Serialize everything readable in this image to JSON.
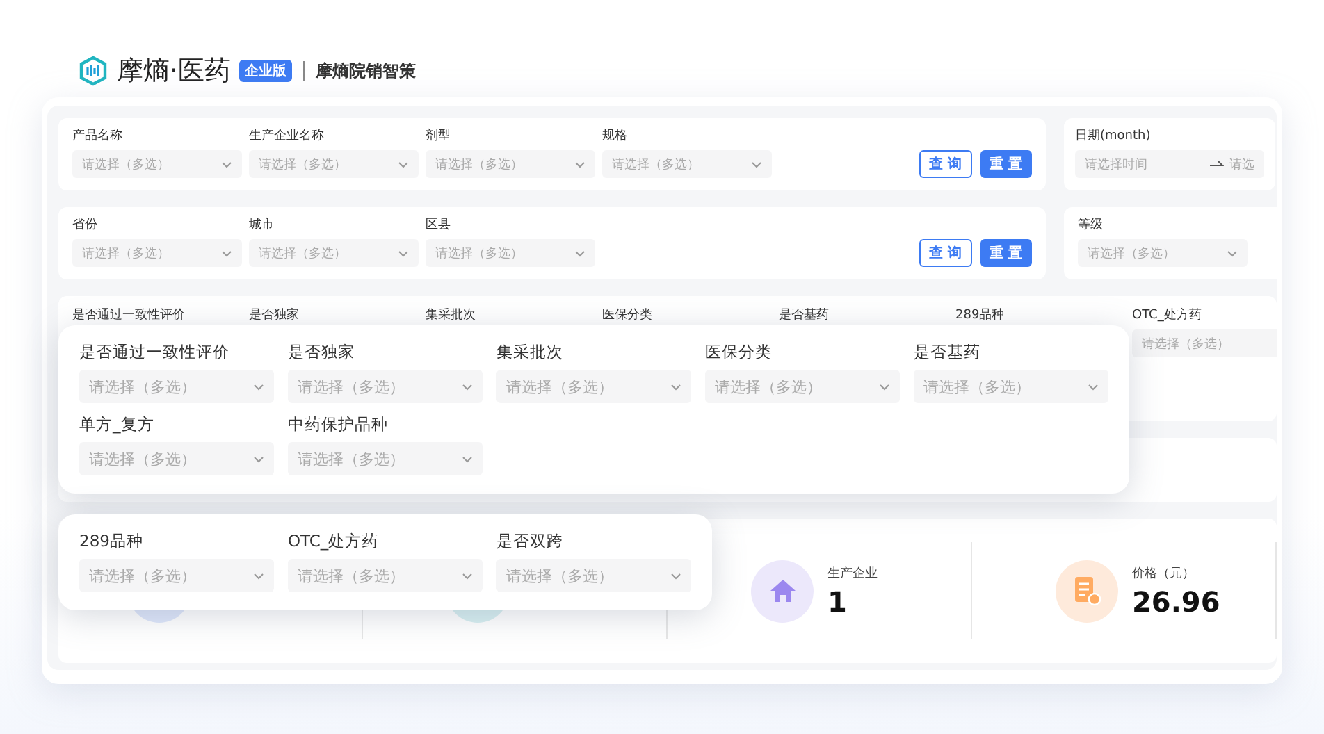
{
  "brand": {
    "name": "摩熵·医药",
    "badge": "企业版",
    "product": "摩熵院销智策"
  },
  "filter_rows": [
    {
      "fields": [
        {
          "label": "产品名称",
          "placeholder": "请选择（多选）"
        },
        {
          "label": "生产企业名称",
          "placeholder": "请选择（多选）"
        },
        {
          "label": "剂型",
          "placeholder": "请选择（多选）"
        },
        {
          "label": "规格",
          "placeholder": "请选择（多选）"
        }
      ],
      "buttons": [
        {
          "label": "查 询",
          "kind": "outline"
        },
        {
          "label": "重 置",
          "kind": "primary"
        }
      ]
    },
    {
      "fields": [
        {
          "label": "省份",
          "placeholder": "请选择（多选）"
        },
        {
          "label": "城市",
          "placeholder": "请选择（多选）"
        },
        {
          "label": "区县",
          "placeholder": "请选择（多选）"
        }
      ],
      "buttons": [
        {
          "label": "查 询",
          "kind": "outline"
        },
        {
          "label": "重 置",
          "kind": "primary"
        }
      ]
    }
  ],
  "date_filter": {
    "label": "日期(month)",
    "start_placeholder": "请选择时间",
    "end_placeholder": "请选"
  },
  "grade_filter": {
    "label": "等级",
    "placeholder": "请选择（多选）"
  },
  "attribute_row": {
    "labels": [
      "是否通过一致性评价",
      "是否独家",
      "集采批次",
      "医保分类",
      "是否基药",
      "289品种",
      "OTC_处方药"
    ],
    "last_placeholder": "请选择（多选）"
  },
  "popups": [
    {
      "rows": [
        [
          {
            "label": "是否通过一致性评价",
            "placeholder": "请选择（多选）"
          },
          {
            "label": "是否独家",
            "placeholder": "请选择（多选）"
          },
          {
            "label": "集采批次",
            "placeholder": "请选择（多选）"
          },
          {
            "label": "医保分类",
            "placeholder": "请选择（多选）"
          },
          {
            "label": "是否基药",
            "placeholder": "请选择（多选）"
          }
        ],
        [
          {
            "label": "单方_复方",
            "placeholder": "请选择（多选）"
          },
          {
            "label": "中药保护品种",
            "placeholder": "请选择（多选）"
          }
        ]
      ]
    },
    {
      "rows": [
        [
          {
            "label": "289品种",
            "placeholder": "请选择（多选）"
          },
          {
            "label": "OTC_处方药",
            "placeholder": "请选择（多选）"
          },
          {
            "label": "是否双跨",
            "placeholder": "请选择（多选）"
          }
        ]
      ]
    }
  ],
  "stats": [
    {
      "kind": "plain",
      "color": "#dde6fb"
    },
    {
      "kind": "plain",
      "color": "#d6eff1"
    },
    {
      "kind": "house",
      "color": "#ece8fb",
      "label": "生产企业",
      "value": "1"
    },
    {
      "kind": "receipt",
      "color": "#feeadb",
      "label": "价格（元）",
      "value": "26.96"
    }
  ]
}
